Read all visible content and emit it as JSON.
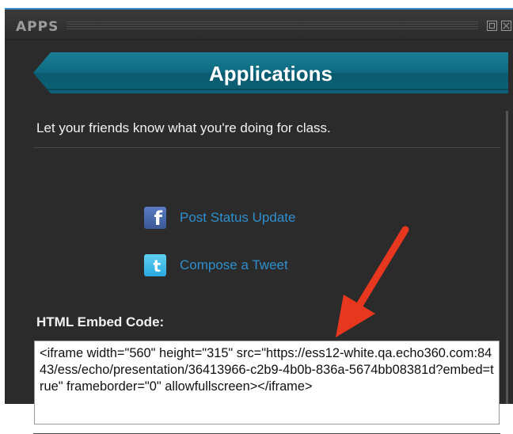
{
  "window": {
    "title": "APPS"
  },
  "banner": {
    "title": "Applications"
  },
  "intro_text": "Let your friends know what you're doing for class.",
  "share_links": [
    {
      "label": "Post Status Update",
      "icon": "facebook-icon",
      "glyph": "f"
    },
    {
      "label": "Compose a Tweet",
      "icon": "twitter-icon",
      "glyph": "t"
    }
  ],
  "embed": {
    "label": "HTML Embed Code:",
    "code": "<iframe width=\"560\" height=\"315\" src=\"https://ess12-white.qa.echo360.com:8443/ess/echo/presentation/36413966-c2b9-4b0b-836a-5674bb08381d?embed=true\" frameborder=\"0\" allowfullscreen></iframe>"
  },
  "colors": {
    "panel_background": "#2b2b2b",
    "banner_teal": "#0e6a80",
    "link_blue": "#2f8fce",
    "annotation_arrow": "#e8371f"
  }
}
